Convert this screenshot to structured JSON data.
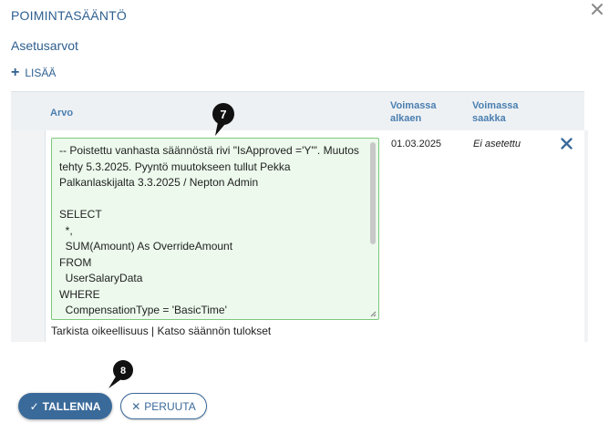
{
  "dialog": {
    "title": "POIMINTASÄÄNTÖ",
    "close_icon": "close-icon"
  },
  "section": {
    "title": "Asetusarvot",
    "add_label": "LISÄÄ"
  },
  "table": {
    "columns": {
      "value": "Arvo",
      "valid_from": "Voimassa\nalkaen",
      "valid_to": "Voimassa\nsaakka"
    },
    "rows": [
      {
        "value": "-- Poistettu vanhasta säännöstä rivi \"IsApproved ='Y'\". Muutos tehty 5.3.2025. Pyyntö muutokseen tullut Pekka Palkanlaskijalta 3.3.2025 / Nepton Admin\n\nSELECT\n  *,\n  SUM(Amount) As OverrideAmount\nFROM\n  UserSalaryData\nWHERE\n  CompensationType = 'BasicTime'",
        "valid_from": "01.03.2025",
        "valid_to": "Ei asetettu",
        "check_link": "Tarkista oikeellisuus",
        "separator": " | ",
        "results_link": "Katso säännön tulokset"
      }
    ]
  },
  "callouts": {
    "badge_7": "7",
    "badge_8": "8"
  },
  "footer": {
    "save_label": "TALLENNA",
    "cancel_label": "PERUUTA"
  },
  "colors": {
    "accent": "#2e5f8f",
    "primary_button": "#3a6a9a",
    "editor_bg": "#ecf9ec",
    "editor_border": "#7ec87e"
  }
}
